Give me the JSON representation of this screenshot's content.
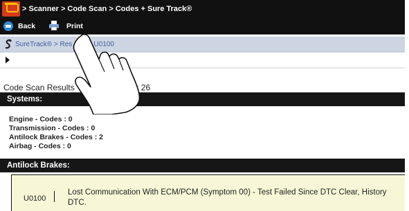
{
  "header": {
    "breadcrumbs": [
      "> Scanner",
      "> Code Scan",
      "> Codes + Sure Track®"
    ]
  },
  "toolbar": {
    "back_label": "Back",
    "print_label": "Print"
  },
  "navbar": {
    "text": "SureTrack® > Res      for U0100"
  },
  "results": {
    "prefix": "Code Scan Results",
    "suffix": "detected : 26"
  },
  "systems": {
    "heading": "Systems:",
    "items": [
      "Engine - Codes : 0",
      "Transmission - Codes : 0",
      "Antilock Brakes - Codes : 2",
      "Airbag - Codes : 0"
    ]
  },
  "antilock": {
    "heading": "Antilock Brakes:",
    "dtc_code": "U0100",
    "dtc_description": "Lost Communication With ECM/PCM (Symptom 00) - Test Failed Since DTC Clear, History DTC."
  },
  "colors": {
    "dark_bar": "#111111",
    "nav_bar": "#cdd5e2",
    "dtc_panel": "#f7f7d8",
    "home_icon": "#d63a1a"
  },
  "icons": [
    "home-icon",
    "back-icon",
    "printer-icon",
    "suretrack-icon",
    "expand-arrow-icon",
    "pointing-hand-icon"
  ]
}
